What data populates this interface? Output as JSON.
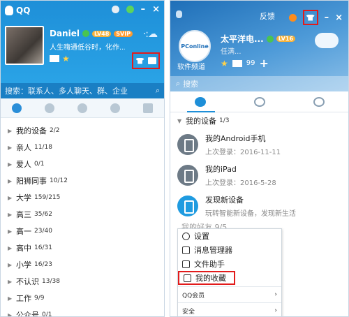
{
  "left": {
    "title": "QQ",
    "user": {
      "name": "Daniel",
      "level_badge": "LV48",
      "vip_badge": "SVIP",
      "signature": "人生嗨通低谷时，化作..."
    },
    "search": {
      "placeholder": "搜索：联系人、多人聊天、群、企业"
    },
    "window_controls": {
      "minimize": "–",
      "close": "×"
    },
    "groups": [
      {
        "name": "我的设备",
        "count": "2/2"
      },
      {
        "name": "亲人",
        "count": "11/18"
      },
      {
        "name": "爱人",
        "count": "0/1"
      },
      {
        "name": "阳狮同事",
        "count": "10/12"
      },
      {
        "name": "大学",
        "count": "159/215"
      },
      {
        "name": "高三",
        "count": "35/62"
      },
      {
        "name": "高一",
        "count": "23/40"
      },
      {
        "name": "高中",
        "count": "16/31"
      },
      {
        "name": "小学",
        "count": "16/23"
      },
      {
        "name": "不认识",
        "count": "13/38"
      },
      {
        "name": "工作",
        "count": "9/9"
      },
      {
        "name": "公众号",
        "count": "0/1"
      }
    ]
  },
  "right": {
    "feedback": "反馈",
    "window_controls": {
      "minimize": "–",
      "close": "×"
    },
    "profile": {
      "name": "太平洋电...",
      "sub": "任满...",
      "level_badge": "LV16",
      "channel": "软件频道",
      "logo_text": "PConline",
      "mail_count": "99",
      "add": "+"
    },
    "search": {
      "placeholder": "搜索"
    },
    "device_group": {
      "name": "我的设备",
      "count": "1/3"
    },
    "devices": [
      {
        "name": "我的Android手机",
        "sub": "上次登录：2016-11-11"
      },
      {
        "name": "我的iPad",
        "sub": "上次登录：2016-5-28"
      },
      {
        "name": "发现新设备",
        "sub": "玩转智能新设备，发现新生活"
      }
    ],
    "menu": {
      "items": [
        "设置",
        "消息管理器",
        "文件助手",
        "我的收藏"
      ],
      "subs": [
        "QQ会员",
        "安全"
      ]
    },
    "behind_text": "我的好友 9/5"
  }
}
